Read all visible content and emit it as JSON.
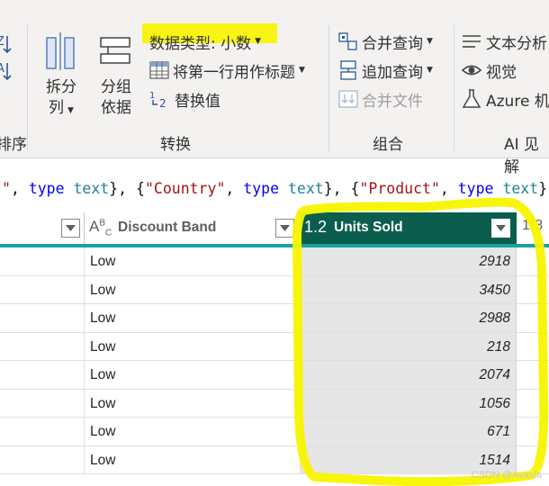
{
  "ribbon": {
    "sort_group_label": "排序",
    "buttons": {
      "split_column": {
        "line1": "拆分",
        "line2": "列"
      },
      "group_by": {
        "line1": "分组",
        "line2": "依据"
      }
    },
    "data_type": "数据类型: 小数",
    "use_first_row_headers": "将第一行用作标题",
    "replace_values": "替换值",
    "transform_label": "转换",
    "merge_queries": "合并查询",
    "append_queries": "追加查询",
    "combine_files": "合并文件",
    "combine_label": "组合",
    "text_analytics": "文本分析",
    "vision": "视觉",
    "azure_ml": "Azure 机",
    "ai_label": "AI 见解"
  },
  "formula_bar": {
    "tokens": [
      {
        "t": "\"",
        "c": "str"
      },
      {
        "t": ", ",
        "c": "p"
      },
      {
        "t": "type",
        "c": "kw"
      },
      {
        "t": " ",
        "c": "p"
      },
      {
        "t": "text",
        "c": "tx"
      },
      {
        "t": "}, {",
        "c": "p"
      },
      {
        "t": "\"Country\"",
        "c": "str"
      },
      {
        "t": ", ",
        "c": "p"
      },
      {
        "t": "type",
        "c": "kw"
      },
      {
        "t": " ",
        "c": "p"
      },
      {
        "t": "text",
        "c": "tx"
      },
      {
        "t": "}, {",
        "c": "p"
      },
      {
        "t": "\"Product\"",
        "c": "str"
      },
      {
        "t": ", ",
        "c": "p"
      },
      {
        "t": "type",
        "c": "kw"
      },
      {
        "t": " ",
        "c": "p"
      },
      {
        "t": "text",
        "c": "tx"
      },
      {
        "t": "}",
        "c": "p"
      }
    ]
  },
  "grid": {
    "columns": [
      {
        "type_icon": "ABC",
        "title": "Discount Band"
      },
      {
        "type_icon": "1.2",
        "title": "Units Sold"
      },
      {
        "type_icon": "1²3",
        "title": ""
      }
    ],
    "rows": [
      {
        "band": "Low",
        "units": "2918"
      },
      {
        "band": "Low",
        "units": "3450"
      },
      {
        "band": "Low",
        "units": "2988"
      },
      {
        "band": "Low",
        "units": "218"
      },
      {
        "band": "Low",
        "units": "2074"
      },
      {
        "band": "Low",
        "units": "1056"
      },
      {
        "band": "Low",
        "units": "671"
      },
      {
        "band": "Low",
        "units": "1514"
      }
    ]
  },
  "watermark": "CSDN @Avasla",
  "colors": {
    "selected_header": "#0b5e4d",
    "teal_bar": "#17a2a0",
    "highlight": "#f8f400"
  }
}
